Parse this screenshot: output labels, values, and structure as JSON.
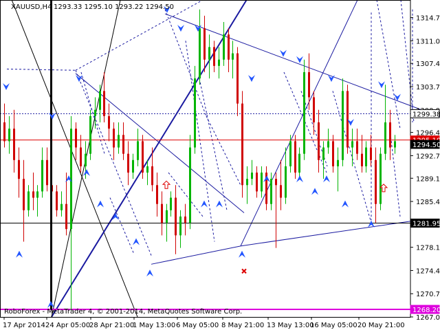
{
  "header": {
    "symbol": "XAUUSD,H4",
    "ohlc": "1293.33 1295.10 1293.22 1294.50"
  },
  "footer": {
    "copyright": "RoboForex - MetaTrader 4, © 2001-2014, MetaQuotes Software Corp."
  },
  "colors": {
    "bull": "#00b400",
    "bear": "#d00000",
    "arrow": "#2255ff",
    "trendline": "#1a1aa0",
    "bidline": "#dd0000",
    "magenta_line": "#dd00dd"
  },
  "chart_data": {
    "type": "candlestick",
    "symbol": "XAUUSD",
    "timeframe": "H4",
    "ylim": [
      1267.0,
      1317.5
    ],
    "y_ticks": [
      "1314.70",
      "1311.00",
      "1307.40",
      "1303.70",
      "1300.00",
      "1296.40",
      "1292.70",
      "1289.10",
      "1285.40",
      "1281.70",
      "1278.10",
      "1274.40",
      "1270.70",
      "1267.00"
    ],
    "x_ticks": [
      "17 Apr 2014",
      "24 Apr 05:00",
      "28 Apr 21:00",
      "1 May 13:00",
      "6 May 05:00",
      "8 May 21:00",
      "13 May 13:00",
      "16 May 05:00",
      "20 May 21:00"
    ],
    "price_labels": [
      {
        "value": 1299.38,
        "text": "1299.38",
        "style": "white"
      },
      {
        "value": 1295.19,
        "text": "1295.19",
        "style": "red"
      },
      {
        "value": 1294.5,
        "text": "1294.50",
        "style": "dark"
      },
      {
        "value": 1281.95,
        "text": "1281.95",
        "style": "dark"
      },
      {
        "value": 1268.2,
        "text": "1268.20",
        "style": "magenta"
      }
    ],
    "hlines": [
      {
        "value": 1299.38,
        "style": "dotted",
        "color": "#1a1aa0"
      },
      {
        "value": 1295.19,
        "style": "solid",
        "color": "#dd0000"
      },
      {
        "value": 1281.95,
        "style": "solid",
        "color": "#000000"
      },
      {
        "value": 1268.2,
        "style": "solid",
        "color": "#dd00dd"
      }
    ],
    "candles": [
      [
        1298,
        1301,
        1294,
        1295
      ],
      [
        1295,
        1299,
        1293,
        1297
      ],
      [
        1297,
        1300,
        1290,
        1292
      ],
      [
        1292,
        1294,
        1286,
        1289
      ],
      [
        1289,
        1292,
        1279,
        1284
      ],
      [
        1284,
        1288,
        1283,
        1287
      ],
      [
        1287,
        1290,
        1284,
        1286
      ],
      [
        1286,
        1288,
        1283,
        1287
      ],
      [
        1287,
        1294,
        1286,
        1292
      ],
      [
        1292,
        1294,
        1287,
        1288
      ],
      [
        1288,
        1290,
        1285,
        1287
      ],
      [
        1287,
        1288,
        1283,
        1284
      ],
      [
        1284,
        1287,
        1283,
        1285
      ],
      [
        1285,
        1290,
        1280,
        1281
      ],
      [
        1281,
        1299,
        1268,
        1297
      ],
      [
        1297,
        1298,
        1292,
        1294
      ],
      [
        1294,
        1296,
        1290,
        1291
      ],
      [
        1291,
        1295,
        1289,
        1293
      ],
      [
        1293,
        1300,
        1292,
        1299
      ],
      [
        1299,
        1302,
        1297,
        1300
      ],
      [
        1300,
        1304,
        1298,
        1303
      ],
      [
        1303,
        1306,
        1298,
        1299
      ],
      [
        1299,
        1301,
        1295,
        1297
      ],
      [
        1297,
        1298,
        1292,
        1294
      ],
      [
        1294,
        1298,
        1293,
        1296
      ],
      [
        1296,
        1298,
        1292,
        1293
      ],
      [
        1293,
        1295,
        1288,
        1290
      ],
      [
        1290,
        1293,
        1289,
        1292
      ],
      [
        1292,
        1297,
        1291,
        1295
      ],
      [
        1295,
        1296,
        1289,
        1290
      ],
      [
        1290,
        1292,
        1288,
        1291
      ],
      [
        1291,
        1294,
        1287,
        1288
      ],
      [
        1288,
        1290,
        1283,
        1285
      ],
      [
        1285,
        1287,
        1280,
        1282
      ],
      [
        1282,
        1285,
        1279,
        1284
      ],
      [
        1284,
        1287,
        1283,
        1286
      ],
      [
        1286,
        1288,
        1277,
        1280
      ],
      [
        1280,
        1284,
        1278,
        1283
      ],
      [
        1283,
        1285,
        1280,
        1282
      ],
      [
        1282,
        1296,
        1281,
        1294
      ],
      [
        1294,
        1307,
        1293,
        1305
      ],
      [
        1305,
        1316,
        1304,
        1313
      ],
      [
        1313,
        1315,
        1306,
        1308
      ],
      [
        1308,
        1312,
        1305,
        1310
      ],
      [
        1310,
        1311,
        1306,
        1307
      ],
      [
        1307,
        1310,
        1305,
        1308
      ],
      [
        1308,
        1314,
        1307,
        1312
      ],
      [
        1312,
        1313,
        1306,
        1308
      ],
      [
        1308,
        1311,
        1305,
        1309
      ],
      [
        1309,
        1310,
        1299,
        1301
      ],
      [
        1301,
        1303,
        1286,
        1288
      ],
      [
        1288,
        1291,
        1285,
        1289
      ],
      [
        1289,
        1292,
        1288,
        1290
      ],
      [
        1290,
        1291,
        1286,
        1287
      ],
      [
        1287,
        1291,
        1286,
        1290
      ],
      [
        1290,
        1291,
        1284,
        1285
      ],
      [
        1285,
        1290,
        1284,
        1289
      ],
      [
        1289,
        1290,
        1278,
        1288
      ],
      [
        1288,
        1292,
        1284,
        1286
      ],
      [
        1286,
        1294,
        1285,
        1291
      ],
      [
        1291,
        1296,
        1290,
        1295
      ],
      [
        1295,
        1296,
        1289,
        1290
      ],
      [
        1290,
        1294,
        1289,
        1293
      ],
      [
        1293,
        1308,
        1292,
        1306
      ],
      [
        1306,
        1309,
        1300,
        1302
      ],
      [
        1302,
        1303,
        1296,
        1298
      ],
      [
        1298,
        1300,
        1290,
        1292
      ],
      [
        1292,
        1295,
        1289,
        1294
      ],
      [
        1294,
        1297,
        1293,
        1295
      ],
      [
        1295,
        1296,
        1290,
        1291
      ],
      [
        1291,
        1294,
        1287,
        1292
      ],
      [
        1292,
        1305,
        1291,
        1303
      ],
      [
        1303,
        1304,
        1293,
        1294
      ],
      [
        1294,
        1297,
        1291,
        1295
      ],
      [
        1295,
        1297,
        1292,
        1293
      ],
      [
        1293,
        1296,
        1290,
        1291
      ],
      [
        1291,
        1295,
        1290,
        1294
      ],
      [
        1294,
        1296,
        1291,
        1292
      ],
      [
        1292,
        1294,
        1282,
        1285
      ],
      [
        1285,
        1294,
        1284,
        1293
      ],
      [
        1293,
        1304,
        1292,
        1298
      ],
      [
        1298,
        1300,
        1292,
        1294
      ],
      [
        1294,
        1296,
        1293,
        1295
      ]
    ],
    "arrows_down": [
      [
        9,
        1303.7
      ],
      [
        76,
        1299
      ],
      [
        115,
        1305
      ],
      [
        243,
        1316
      ],
      [
        263,
        1313
      ],
      [
        288,
        1313
      ],
      [
        366,
        1305
      ],
      [
        412,
        1309
      ],
      [
        436,
        1308
      ],
      [
        482,
        1305
      ],
      [
        510,
        1298
      ],
      [
        555,
        1304
      ],
      [
        578,
        1302
      ]
    ],
    "arrows_up": [
      [
        28,
        1277
      ],
      [
        74,
        1269
      ],
      [
        100,
        1289
      ],
      [
        126,
        1290
      ],
      [
        146,
        1285
      ],
      [
        168,
        1283
      ],
      [
        198,
        1279
      ],
      [
        218,
        1274
      ],
      [
        297,
        1285
      ],
      [
        319,
        1285
      ],
      [
        352,
        1277
      ],
      [
        388,
        1289
      ],
      [
        436,
        1289
      ],
      [
        458,
        1287
      ],
      [
        475,
        1289
      ],
      [
        502,
        1285
      ],
      [
        540,
        1281.8
      ]
    ],
    "hollow_up_arrows": [
      [
        242,
        1288
      ],
      [
        558,
        1287.5
      ]
    ],
    "cross_marker": [
      355,
      1274.3
    ],
    "trend_lines": [
      {
        "points": [
          [
            -10,
            1325
          ],
          [
            200,
            1267
          ]
        ],
        "color": "#000000",
        "width": 1
      },
      {
        "points": [
          [
            75,
            1267
          ],
          [
            367,
            1319
          ]
        ],
        "color": "#1a1aa0",
        "width": 2
      },
      {
        "points": [
          [
            75,
            1267
          ],
          [
            175,
            1317.5
          ]
        ],
        "color": "#000000",
        "width": 1
      },
      {
        "points": [
          [
            240,
            1315.3
          ],
          [
            640,
            1298.9
          ]
        ],
        "color": "#1a1aa0",
        "width": 1
      },
      {
        "points": [
          [
            110,
            1305.8
          ],
          [
            355,
            1283.6
          ]
        ],
        "color": "#1a1aa0",
        "width": 1
      },
      {
        "points": [
          [
            220,
            1275.4
          ],
          [
            350,
            1278.3
          ]
        ],
        "color": "#1a1aa0",
        "width": 1
      },
      {
        "points": [
          [
            350,
            1278.3
          ],
          [
            600,
            1282.3
          ]
        ],
        "color": "#1a1aa0",
        "width": 1
      },
      {
        "points": [
          [
            350,
            1278.3
          ],
          [
            520,
            1317.5
          ]
        ],
        "color": "#1a1aa0",
        "width": 1
      }
    ],
    "projection_lines": [
      [
        [
          10,
          1306.5
        ],
        [
          110,
          1306.3
        ]
      ],
      [
        [
          110,
          1306.3
        ],
        [
          295,
          1317.5
        ]
      ],
      [
        [
          110,
          1306.3
        ],
        [
          220,
          1276.8
        ]
      ],
      [
        [
          118,
          1306
        ],
        [
          152,
          1293
        ]
      ],
      [
        [
          160,
          1286
        ],
        [
          195,
          1277
        ]
      ],
      [
        [
          240,
          1316
        ],
        [
          300,
          1299
        ]
      ],
      [
        [
          300,
          1299
        ],
        [
          350,
          1288
        ]
      ],
      [
        [
          270,
          1311
        ],
        [
          312,
          1279
        ]
      ],
      [
        [
          290,
          1305
        ],
        [
          330,
          1284
        ]
      ],
      [
        [
          245,
          1290
        ],
        [
          295,
          1283
        ]
      ],
      [
        [
          413,
          1306
        ],
        [
          475,
          1290
        ]
      ],
      [
        [
          438,
          1303
        ],
        [
          476,
          1291
        ]
      ],
      [
        [
          484,
          1303
        ],
        [
          540,
          1282
        ]
      ],
      [
        [
          540,
          1315.5
        ],
        [
          540,
          1282.4
        ]
      ],
      [
        [
          548,
          1317.5
        ],
        [
          582,
          1297
        ]
      ],
      [
        [
          567,
          1297
        ],
        [
          582,
          1283
        ]
      ],
      [
        [
          583,
          1317.5
        ],
        [
          602,
          1298
        ]
      ],
      [
        [
          600,
          1316
        ],
        [
          600,
          1298
        ]
      ]
    ]
  }
}
